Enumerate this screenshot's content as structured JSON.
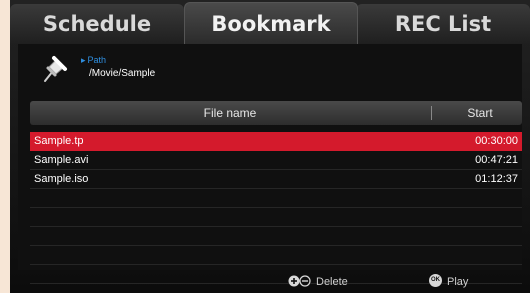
{
  "tabs": [
    {
      "label": "Schedule",
      "active": false
    },
    {
      "label": "Bookmark",
      "active": true
    },
    {
      "label": "REC List",
      "active": false
    }
  ],
  "path": {
    "label": "Path",
    "value": "/Movie/Sample"
  },
  "table": {
    "headers": {
      "name": "File name",
      "start": "Start"
    },
    "rows": [
      {
        "name": "Sample.tp",
        "start": "00:30:00",
        "selected": true
      },
      {
        "name": "Sample.avi",
        "start": "00:47:21",
        "selected": false
      },
      {
        "name": "Sample.iso",
        "start": "01:12:37",
        "selected": false
      }
    ]
  },
  "footer": {
    "delete_label": "Delete",
    "ok_icon_text": "OK",
    "play_label": "Play"
  },
  "colors": {
    "selection": "#d41a2c",
    "path_label": "#2f8fe0"
  }
}
